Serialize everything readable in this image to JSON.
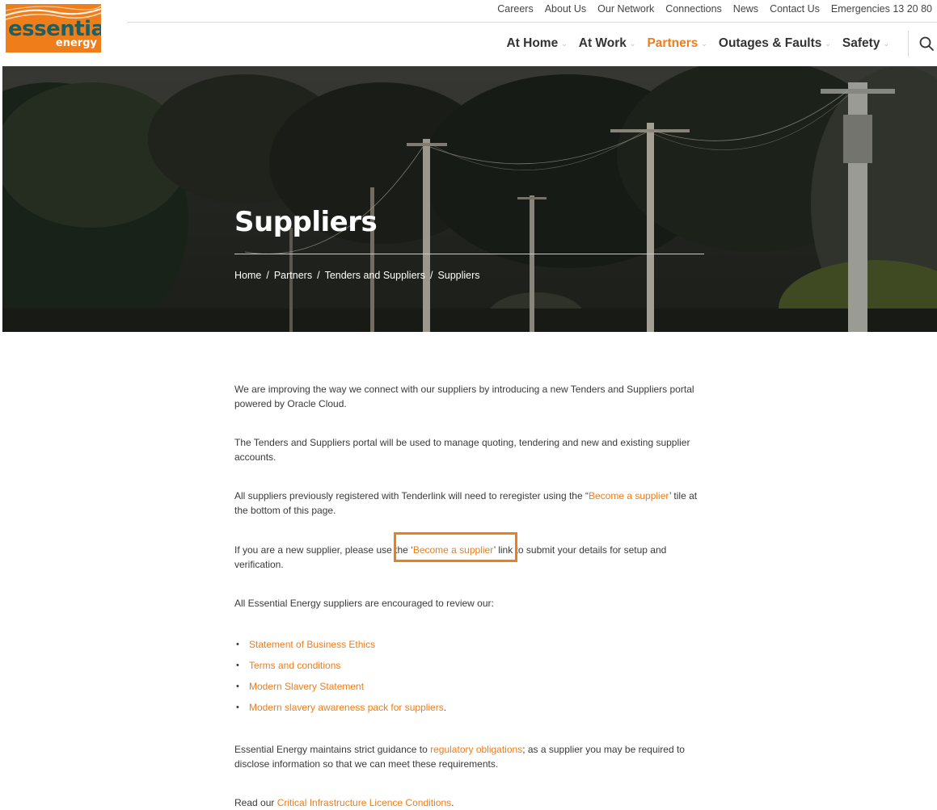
{
  "brand": {
    "logo_word": "essential",
    "logo_word2": "energy",
    "accent_color": "#ef7d1a",
    "logo_text_color": "#1d5f63"
  },
  "util_nav": [
    "Careers",
    "About Us",
    "Our Network",
    "Connections",
    "News",
    "Contact Us",
    "Emergencies 13 20 80"
  ],
  "main_nav": [
    {
      "label": "At Home",
      "active": false
    },
    {
      "label": "At Work",
      "active": false
    },
    {
      "label": "Partners",
      "active": true
    },
    {
      "label": "Outages & Faults",
      "active": false
    },
    {
      "label": "Safety",
      "active": false
    }
  ],
  "icons": {
    "search": "search-icon",
    "chevron": "chevron-down-icon"
  },
  "hero": {
    "title": "Suppliers",
    "breadcrumb": [
      "Home",
      "Partners",
      "Tenders and Suppliers",
      "Suppliers"
    ],
    "separator": "/"
  },
  "content": {
    "p1": "We are improving the way we connect with our suppliers by introducing a new Tenders and Suppliers portal powered by Oracle Cloud.",
    "p2": "The Tenders and Suppliers portal will be used to manage quoting, tendering and new and existing supplier accounts.",
    "p3_before": "All suppliers previously registered with Tenderlink will need to reregister using the “",
    "p3_link": "Become a supplier",
    "p3_after": "’ tile at the bottom of this page.",
    "p4_before": "If you are a new supplier, please use the ‘",
    "p4_link": "Become a supplier",
    "p4_after": "’ link to submit your details for setup and verification.",
    "p5": "All Essential Energy suppliers are encouraged to review our:",
    "bullets": [
      {
        "link": "Statement of Business Ethics",
        "suffix": ""
      },
      {
        "link": "Terms and conditions",
        "suffix": ""
      },
      {
        "link": "Modern Slavery Statement",
        "suffix": ""
      },
      {
        "link": "Modern slavery awareness pack for suppliers",
        "suffix": "."
      }
    ],
    "p6_before": "Essential Energy maintains strict guidance to ",
    "p6_link": "regulatory obligations",
    "p6_after": "; as a supplier you may be required to disclose information so that we can meet these requirements.",
    "p7_before": "Read our ",
    "p7_link": "Critical Infrastructure Licence Conditions",
    "p7_after": "."
  }
}
